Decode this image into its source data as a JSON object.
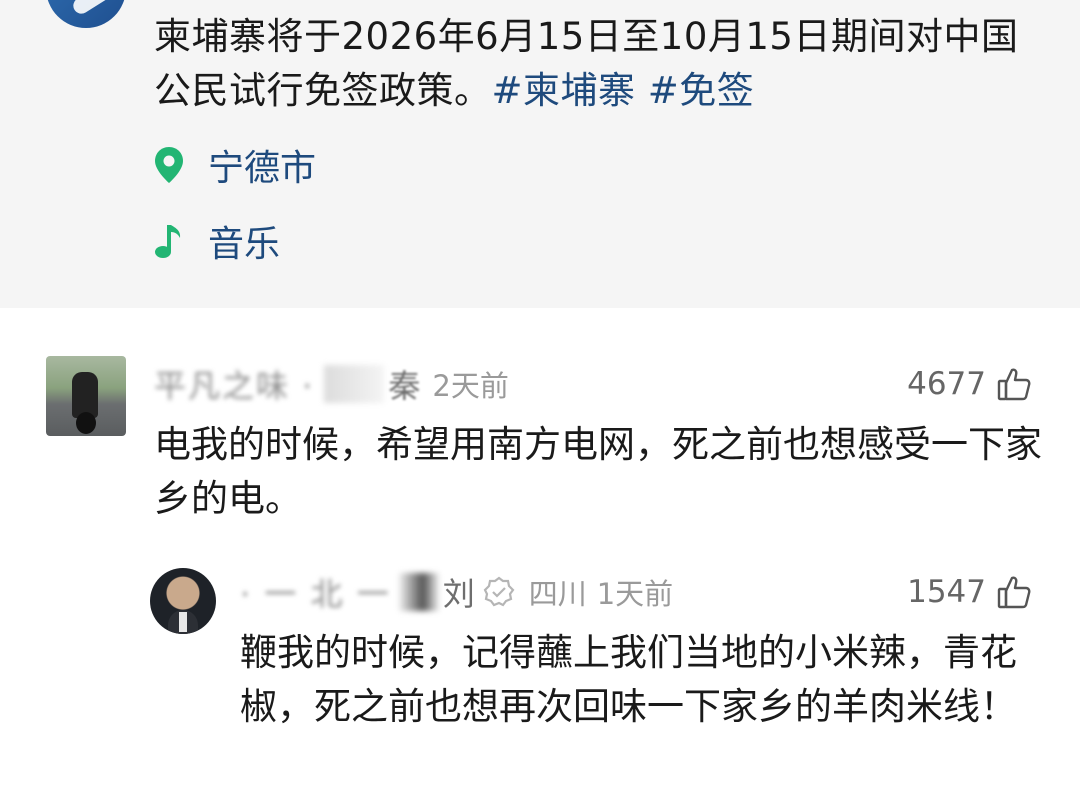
{
  "post": {
    "text": "柬埔寨将于2026年6月15日至10月15日期间对中国公民试行免签政策。",
    "hashtags": [
      "#柬埔寨",
      "#免签"
    ],
    "location": "宁德市",
    "music": "音乐",
    "icons": {
      "location": "location-pin-icon",
      "music": "music-note-icon"
    },
    "accent_color": "#1e4a7d",
    "icon_color": "#22b573"
  },
  "comments": [
    {
      "username_blurred": "平凡之味 ·",
      "name_tail": "秦",
      "time": "2天前",
      "likes": "4677",
      "text": "电我的时候，希望用南方电网，死之前也想感受一下家乡的电。"
    },
    {
      "username_blurred": "· 一 北 一",
      "name_tail": "刘",
      "location": "四川",
      "time": "1天前",
      "likes": "1547",
      "text": "鞭我的时候，记得蘸上我们当地的小米辣，青花椒，死之前也想再次回味一下家乡的羊肉米线！",
      "is_reply": true
    }
  ]
}
